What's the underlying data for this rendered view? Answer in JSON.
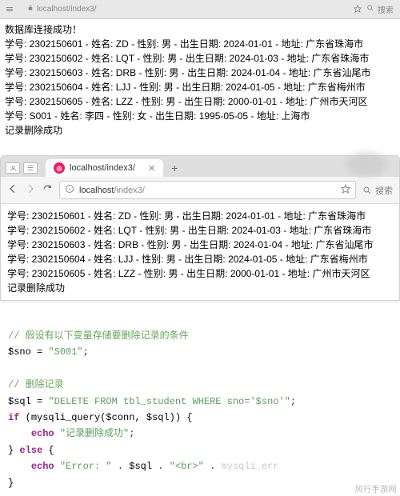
{
  "top_bar": {
    "url": "localhost/index3/",
    "search_placeholder": "搜索"
  },
  "page": {
    "connect_success": "数据库连接成功！",
    "records": [
      "学号: 2302150601 - 姓名: ZD - 性别: 男 - 出生日期: 2024-01-01 - 地址: 广东省珠海市",
      "学号: 2302150602 - 姓名: LQT - 性别: 男 - 出生日期: 2024-01-03 - 地址: 广东省珠海市",
      "学号: 2302150603 - 姓名: DRB - 性别: 男 - 出生日期: 2024-01-04 - 地址: 广东省汕尾市",
      "学号: 2302150604 - 姓名: LJJ - 性别: 男 - 出生日期: 2024-01-05 - 地址: 广东省梅州市",
      "学号: 2302150605 - 姓名: LZZ - 性别: 男 - 出生日期: 2000-01-01 - 地址: 广州市天河区",
      "学号: S001 - 姓名: 李四 - 性别: 女 - 出生日期: 1995-05-05 - 地址: 上海市"
    ],
    "delete_success": "记录删除成功"
  },
  "inner_window": {
    "tab_title": "localhost/index3/",
    "url_display_host": "localhost",
    "url_display_path": "/index3/",
    "search_placeholder": "搜索",
    "records": [
      "学号: 2302150601 - 姓名: ZD - 性别: 男 - 出生日期: 2024-01-01 - 地址: 广东省珠海市",
      "学号: 2302150602 - 姓名: LQT - 性别: 男 - 出生日期: 2024-01-03 - 地址: 广东省珠海市",
      "学号: 2302150603 - 姓名: DRB - 性别: 男 - 出生日期: 2024-01-04 - 地址: 广东省汕尾市",
      "学号: 2302150604 - 姓名: LJJ - 性别: 男 - 出生日期: 2024-01-05 - 地址: 广东省梅州市",
      "学号: 2302150605 - 姓名: LZZ - 性别: 男 - 出生日期: 2000-01-01 - 地址: 广州市天河区"
    ],
    "delete_success": "记录删除成功"
  },
  "code": {
    "comment1": "// 假设有以下变量存储要删除记录的条件",
    "line_var": "$sno = ",
    "line_var_val": "\"S001\"",
    "semi": ";",
    "comment2": "// 删除记录",
    "sql_assign_var": "$sql = ",
    "sql_string": "\"DELETE FROM tbl_student WHERE sno='$sno'\"",
    "if_kw": "if",
    "if_cond_open": " (",
    "mysqli_query": "mysqli_query",
    "if_args": "($conn, $sql)",
    "if_close": ") {",
    "echo_kw": "echo",
    "echo_success": " \"记录删除成功\"",
    "else_line": "} ",
    "else_kw": "else",
    "else_brace": " {",
    "echo_error_prefix": " \"Error: \"",
    "dot1": " . ",
    "sql_var": "$sql",
    "dot2": " . ",
    "br_str": "\"<br>\"",
    "dot3": " . ",
    "mysqli_err": "mysqli_err",
    "close_brace": "}"
  },
  "watermark": "风行手游网"
}
